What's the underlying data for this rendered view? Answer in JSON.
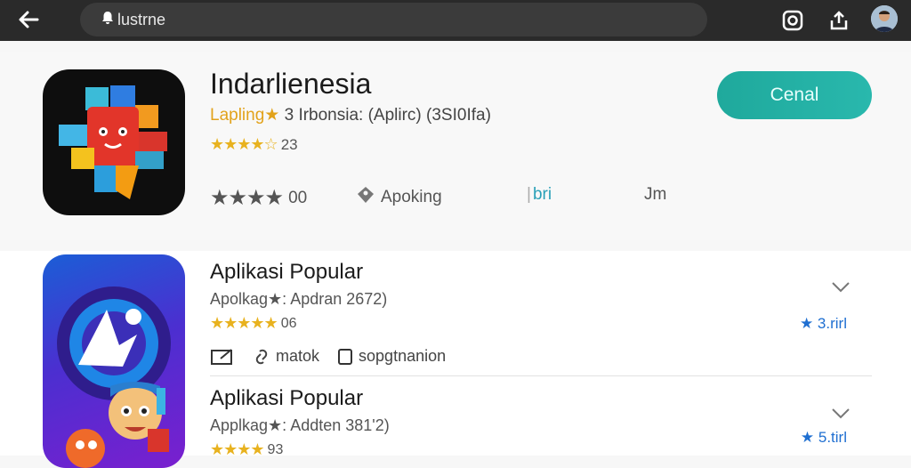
{
  "topbar": {
    "url_text": "lustrne",
    "back_icon": "arrow-left-icon",
    "icons": [
      "instagram-icon",
      "share-icon"
    ]
  },
  "featured": {
    "title": "Indarlienesia",
    "subtitle_accent": "Lapling★",
    "subtitle_rest": "3 Irbonsia: (Aplirc) (3SI0Ifa)",
    "stars": "★★★★☆",
    "rating_count": "23",
    "meta": {
      "rating_stars": "★★★★",
      "rating_value": "00",
      "category": "Apoking",
      "size": "bri",
      "extra": "Jm"
    },
    "open_button": "Cenal",
    "colors": {
      "accent": "#29b8ad",
      "star": "#e8b21f"
    }
  },
  "list": {
    "items": [
      {
        "title": "Aplikasi Popular",
        "subtitle": "Apolkag★: Apdran 2672)",
        "stars": "★★★★★",
        "rating": "06",
        "badge": "★ 3.rirl",
        "actions": [
          "matok",
          "sopgtnanion"
        ]
      },
      {
        "title": "Aplikasi Popular",
        "subtitle": "Applkag★: Addten 381'2)",
        "stars": "★★★★",
        "rating": "93",
        "badge": "★ 5.tirl"
      }
    ]
  }
}
